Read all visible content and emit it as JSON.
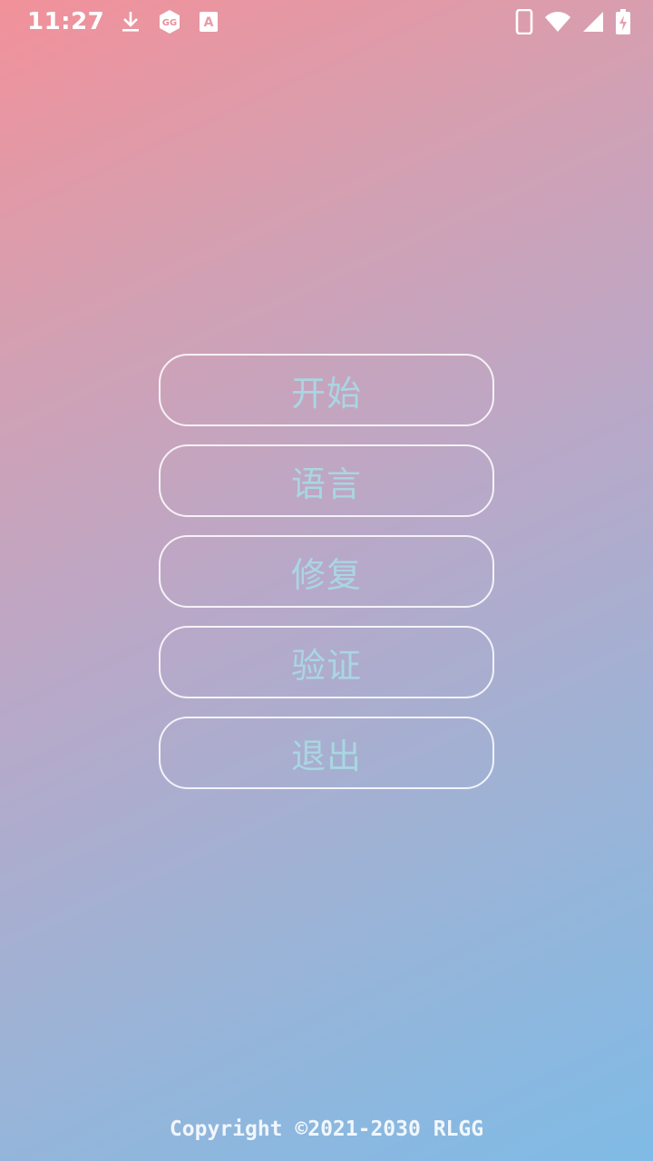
{
  "status_bar": {
    "time": "11:27",
    "icons_left": [
      "download-icon",
      "gg-app-icon",
      "font-a-icon"
    ],
    "icons_right": [
      "phone-icon",
      "wifi-icon",
      "cell-signal-icon",
      "battery-charging-icon"
    ],
    "gg_icon_text": "GG",
    "a_icon_text": "A"
  },
  "menu": {
    "items": [
      {
        "label": "开始"
      },
      {
        "label": "语言"
      },
      {
        "label": "修复"
      },
      {
        "label": "验证"
      },
      {
        "label": "退出"
      }
    ]
  },
  "footer": {
    "copyright": "Copyright ©2021-2030 RLGG"
  },
  "colors": {
    "gradient_start": "#f2919a",
    "gradient_end": "#7fbbe6",
    "button_text": "#a9d6e2",
    "button_border": "#ffffff"
  }
}
